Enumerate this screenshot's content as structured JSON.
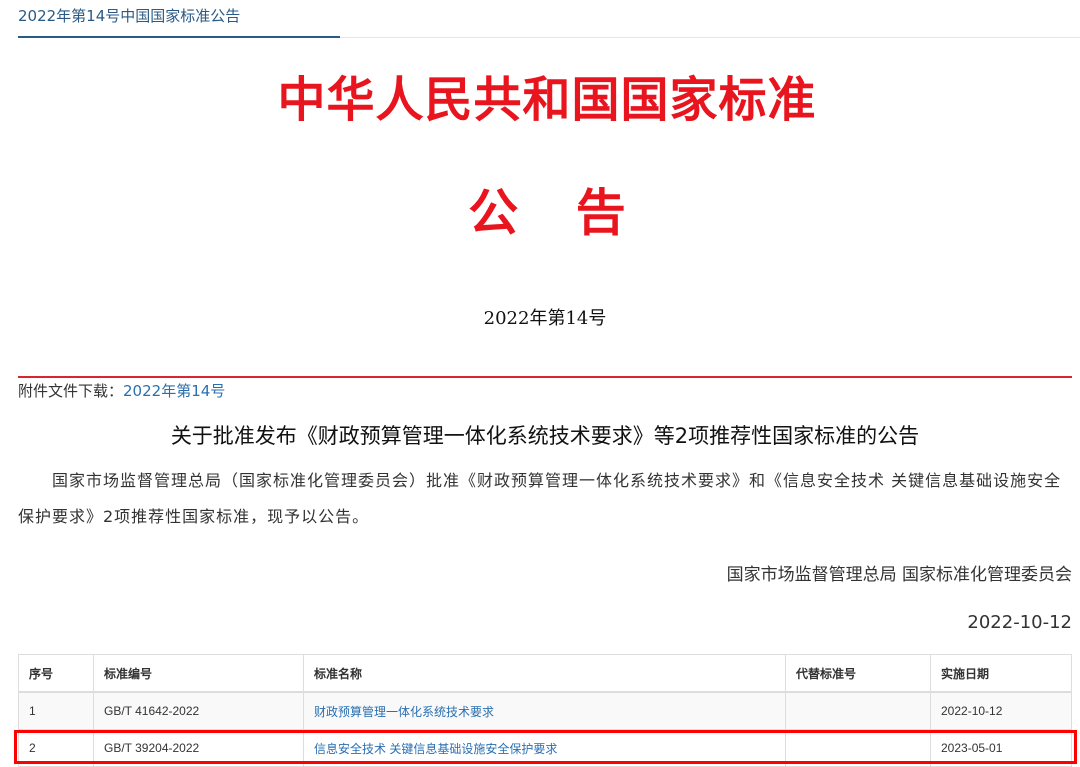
{
  "breadcrumb": "2022年第14号中国国家标准公告",
  "title": "中华人民共和国国家标准",
  "subtitle": "公 告",
  "issue": "2022年第14号",
  "attachment": {
    "label": "附件文件下载：",
    "link": "2022年第14号"
  },
  "heading": "关于批准发布《财政预算管理一体化系统技术要求》等2项推荐性国家标准的公告",
  "body": "国家市场监督管理总局（国家标准化管理委员会）批准《财政预算管理一体化系统技术要求》和《信息安全技术 关键信息基础设施安全保护要求》2项推荐性国家标准，现予以公告。",
  "signature": "国家市场监督管理总局 国家标准化管理委员会",
  "date": "2022-10-12",
  "table": {
    "headers": [
      "序号",
      "标准编号",
      "标准名称",
      "代替标准号",
      "实施日期"
    ],
    "rows": [
      [
        "1",
        "GB/T 41642-2022",
        "财政预算管理一体化系统技术要求",
        "",
        "2022-10-12"
      ],
      [
        "2",
        "GB/T 39204-2022",
        "信息安全技术 关键信息基础设施安全保护要求",
        "",
        "2023-05-01"
      ]
    ]
  }
}
